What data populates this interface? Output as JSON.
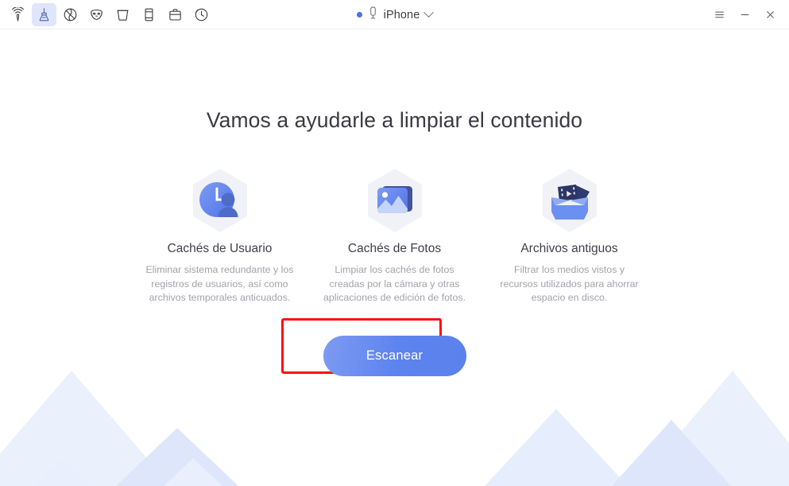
{
  "window": {
    "toolbar": [
      {
        "name": "wifi-transfer-icon",
        "label": "Transferencia",
        "active": false
      },
      {
        "name": "broom-icon",
        "label": "Limpiar",
        "active": true
      },
      {
        "name": "globe-eraser-icon",
        "label": "Borrar datos",
        "active": false
      },
      {
        "name": "mask-icon",
        "label": "Privacidad",
        "active": false
      },
      {
        "name": "trash-bin-icon",
        "label": "Papelera",
        "active": false
      },
      {
        "name": "phone-icon",
        "label": "Dispositivo",
        "active": false
      },
      {
        "name": "briefcase-icon",
        "label": "Caja de herramientas",
        "active": false
      },
      {
        "name": "clock-history-icon",
        "label": "Historial",
        "active": false
      }
    ],
    "device": {
      "status_dot_color": "#4d6fe0",
      "phone_icon": "phone-icon",
      "name": "iPhone",
      "chevron": "chevron-down-icon"
    },
    "controls": {
      "menu_label": "menu-icon",
      "minimize_label": "minimize-icon",
      "close_label": "close-icon"
    }
  },
  "main": {
    "title": "Vamos a ayudarle a limpiar el contenido",
    "features": [
      {
        "icon": "user-cache-clock-icon",
        "title": "Cachés de Usuario",
        "desc": "Eliminar sistema redundante y los registros de usuarios, así como archivos temporales anticuados."
      },
      {
        "icon": "photo-cache-image-icon",
        "title": "Cachés de Fotos",
        "desc": "Limpiar los cachés de fotos creadas por la cámara y otras aplicaciones de edición de fotos."
      },
      {
        "icon": "old-files-box-icon",
        "title": "Archivos antiguos",
        "desc": "Filtrar los medios vistos y recursos utilizados para ahorrar espacio en disco."
      }
    ],
    "scan_button": {
      "label": "Escanear",
      "gradient_from": "#7e9bf2",
      "gradient_to": "#5b81ee"
    },
    "highlight": {
      "name": "red-annotation-box",
      "color": "#fb0f10"
    }
  },
  "decor": {
    "mountain_fill_light": "#eaf0fc",
    "mountain_fill_mid": "#dde6fa"
  }
}
